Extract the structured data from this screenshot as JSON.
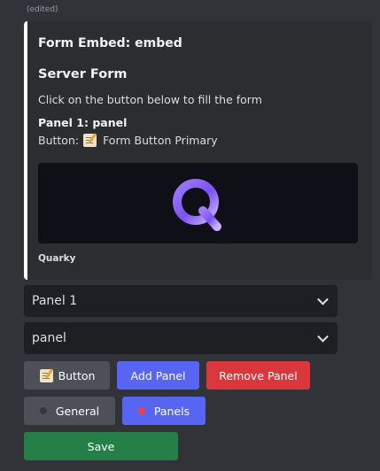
{
  "message": {
    "edited_label": "(edited)"
  },
  "embed": {
    "border_color": "#ffffff",
    "author": "Form Embed: embed",
    "title": "Server Form",
    "description": "Click on the button below to fill the form",
    "panel_name": "Panel 1: panel",
    "button_label_prefix": "Button:",
    "button_label": "Form Button Primary",
    "button_emoji": "memo-icon",
    "image_logo": "quarky-q-logo",
    "footer": "Quarky"
  },
  "selects": {
    "panel_select": {
      "value": "Panel 1",
      "icon": "chevron-down-icon"
    },
    "panel_name_select": {
      "value": "panel",
      "icon": "chevron-down-icon"
    }
  },
  "buttons": {
    "button": {
      "label": "Button",
      "emoji": "memo-icon",
      "color": "#4e5058"
    },
    "add_panel": {
      "label": "Add Panel",
      "color": "#5865f2"
    },
    "remove_panel": {
      "label": "Remove Panel",
      "color": "#da373c"
    },
    "general": {
      "label": "General",
      "dot_color": "#35373c",
      "color": "#4e5058"
    },
    "panels": {
      "label": "Panels",
      "dot_color": "#f23f42",
      "color": "#5865f2"
    },
    "save": {
      "label": "Save",
      "color": "#248046"
    }
  }
}
